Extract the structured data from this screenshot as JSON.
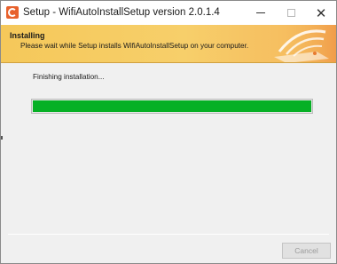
{
  "window": {
    "title": "Setup - WifiAutoInstallSetup version 2.0.1.4",
    "controls": {
      "minimize": "—",
      "maximize": "☐",
      "close": "✕"
    }
  },
  "header": {
    "title": "Installing",
    "subtitle": "Please wait while Setup installs WifiAutoInstallSetup on your computer.",
    "graphic_icon": "wifi-router-icon"
  },
  "main": {
    "status": "Finishing installation...",
    "progress_fraction": 1.0
  },
  "footer": {
    "cancel_label": "Cancel",
    "cancel_enabled": false
  },
  "colors": {
    "progress_fill": "#06b025",
    "header_bg": "#f5c85a",
    "app_icon": "#e8612c"
  }
}
